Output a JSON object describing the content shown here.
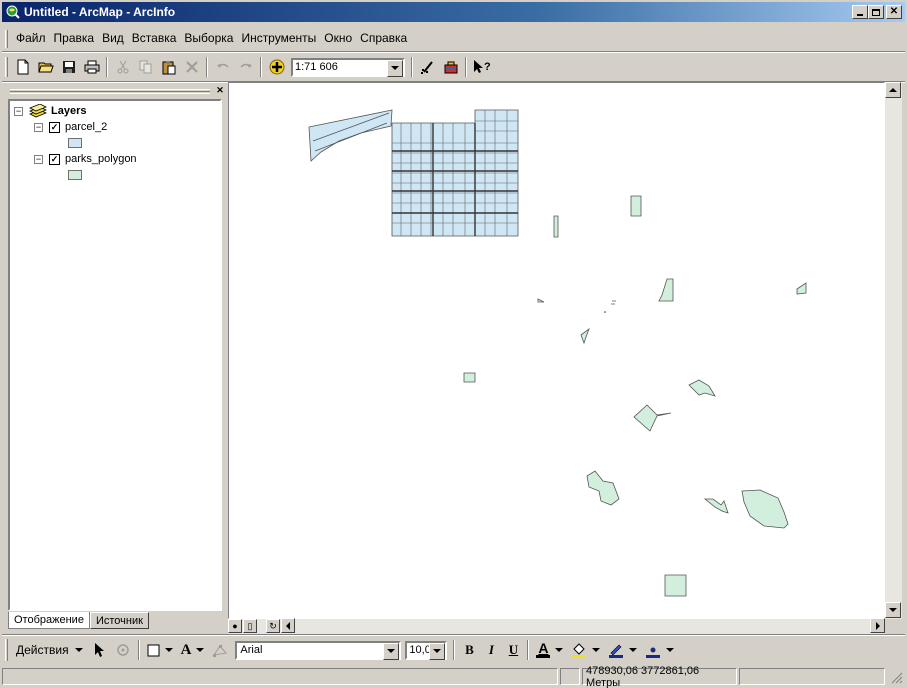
{
  "window": {
    "title": "Untitled - ArcMap - ArcInfo",
    "controls": [
      "minimize",
      "maximize",
      "close"
    ]
  },
  "menu": {
    "items": [
      "Файл",
      "Правка",
      "Вид",
      "Вставка",
      "Выборка",
      "Инструменты",
      "Окно",
      "Справка"
    ]
  },
  "toolbar": {
    "icons": [
      "new-document-icon",
      "open-folder-icon",
      "save-icon",
      "print-icon",
      "cut-icon",
      "copy-icon",
      "paste-icon",
      "delete-icon",
      "undo-icon",
      "redo-icon",
      "add-data-icon",
      "editor-toolbar-icon",
      "arctoolbox-icon",
      "whats-this-icon"
    ],
    "scale": "1:71 606"
  },
  "toc": {
    "root_label": "Layers",
    "layers": [
      {
        "name": "parcel_2",
        "checked": true,
        "fill": "#cfe6f5"
      },
      {
        "name": "parks_polygon",
        "checked": true,
        "fill": "#d2eedd"
      }
    ],
    "tabs": [
      "Отображение",
      "Источник"
    ]
  },
  "draw_toolbar": {
    "actions_label": "Действия",
    "font": "Arial",
    "font_size": "10,0",
    "bold": "B",
    "italic": "I",
    "underline": "U",
    "text_color_label": "A"
  },
  "status": {
    "coordinates": "478930,06  3772861,06 Метры"
  },
  "colors": {
    "title_gradient_start": "#0a246a",
    "parcel_fill": "#cfe6f5",
    "park_fill": "#d2eedd"
  }
}
